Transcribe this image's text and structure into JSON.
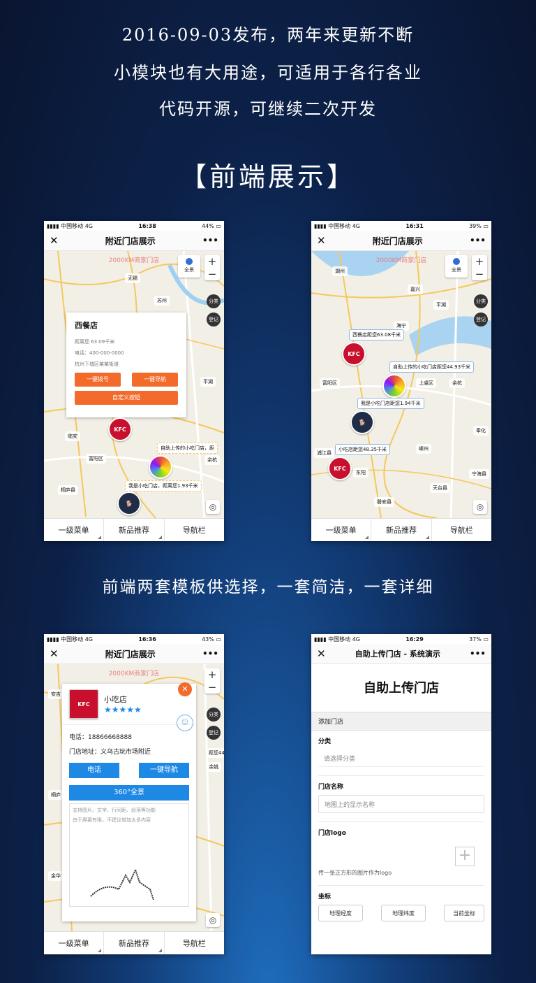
{
  "headlines": [
    "2016-09-03发布，两年来更新不断",
    "小模块也有大用途，可适用于各行各业",
    "代码开源，可继续二次开发"
  ],
  "section_title": "【前端展示】",
  "caption": "前端两套模板供选择，一套简洁，一套详细",
  "common": {
    "carrier": "中国移动",
    "network": "4G",
    "close_icon": "✕",
    "more_icon": "•••",
    "map_watermark": "2000KM商家门店",
    "zoom_in": "+",
    "zoom_out": "−",
    "pano_label": "全景",
    "category_btn": "分类",
    "register_btn": "登记",
    "tabs": [
      "一级菜单",
      "新品推荐",
      "导航栏"
    ]
  },
  "phone1": {
    "time": "16:38",
    "battery": "44%",
    "title": "附近门店展示",
    "popup": {
      "name": "西餐店",
      "distance": "距离您 63.09千米",
      "phone": "电话：400-000-0000",
      "address": "杭州下城区某某街道",
      "call_btn": "一键拨号",
      "nav_btn": "一键导航",
      "custom_btn": "自定义按钮"
    },
    "label_upload": "自助上传的小吃门店，距",
    "label_snack": "我是小吃门店，距离您1.93千米",
    "city_labels": [
      "无锡",
      "苏州",
      "临安",
      "富阳区",
      "桐庐县",
      "余杭",
      "平湖"
    ]
  },
  "phone2": {
    "time": "16:31",
    "battery": "39%",
    "title": "附近门店展示",
    "labels": [
      "西餐店距您63.08千米",
      "自助上传的小吃门店距您44.93千米",
      "我是小吃门店距您1.94千米",
      "小吃店距您48.35千米"
    ],
    "city_labels": [
      "湖州",
      "嘉兴",
      "平湖",
      "富阳区",
      "海宁",
      "余杭",
      "上虞区",
      "嵊州",
      "浦江县",
      "东阳",
      "天台县",
      "磐安县",
      "宁海县",
      "奉化"
    ]
  },
  "phone3": {
    "time": "16:36",
    "battery": "43%",
    "title": "附近门店展示",
    "store_name": "小吃店",
    "stars": "★★★★★",
    "close_x": "✕",
    "phone": "电话：18866668888",
    "address": "门店地址：义乌古玩市场附近",
    "call_btn": "电话",
    "nav_btn": "一键导航",
    "pano_btn": "360°全景",
    "desc1": "支持图片、文字、行间距、段落等功能",
    "desc2": "由于屏幕有限，不建议增加太多内容",
    "side_text": "距您44",
    "city_labels": [
      "安吉",
      "桐庐",
      "金华",
      "余姚"
    ]
  },
  "phone4": {
    "time": "16:29",
    "battery": "37%",
    "title": "自助上传门店 - 系统演示",
    "page_title": "自助上传门店",
    "section": "添加门店",
    "category_label": "分类",
    "category_placeholder": "请选择分类",
    "name_label": "门店名称",
    "name_placeholder": "地图上的显示名称",
    "logo_label": "门店logo",
    "logo_plus": "+",
    "logo_hint": "传一张正方形的图片作为logo",
    "coord_label": "坐标",
    "lng_btn": "地理经度",
    "lat_btn": "地理纬度",
    "cur_btn": "当前坐标"
  }
}
